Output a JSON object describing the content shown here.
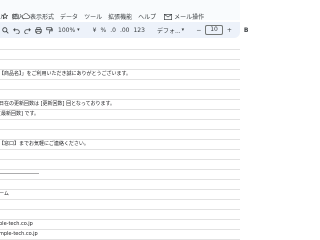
{
  "menu": {
    "items": [
      "ル",
      "挿入",
      "表示形式",
      "データ",
      "ツール",
      "拡張機能",
      "ヘルプ"
    ],
    "extra_label": "メール操作"
  },
  "toolbar": {
    "zoom": "100%",
    "currency": "¥",
    "percent": "%",
    "decimal_decrease": ".0",
    "decimal_increase": ".00",
    "number_format": "123",
    "font": "デフォ...",
    "minus": "−",
    "font_size": "10",
    "plus": "+",
    "bold": "B"
  },
  "sheet": {
    "rows": [
      "",
      "",
      "",
      "【商品名】」をご利用いただき誠にありがとうございます。",
      "",
      "",
      "日在の更新回数は [更新回数] 回となっております。",
      "[最新回数] です。",
      "",
      "",
      "【窓口】までお気軽にご連絡ください。",
      "",
      "",
      "――――――――",
      "",
      "ーム",
      "",
      "",
      "ple-tech.co.jp",
      "mple-tech.co.jp",
      "",
      ""
    ]
  },
  "colors": {
    "toolbar_bg": "#edf2fa",
    "grid": "#e2e2e2",
    "text": "#3c4043"
  }
}
